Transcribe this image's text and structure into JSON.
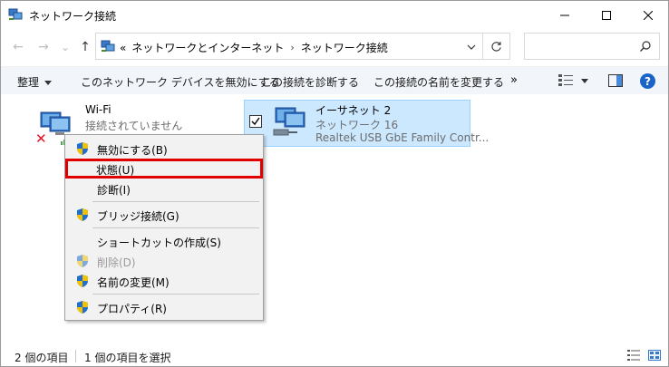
{
  "window": {
    "title": "ネットワーク接続"
  },
  "nav": {
    "back": "←",
    "forward": "→",
    "dropdown": "⌄",
    "up": "↑",
    "breadcrumb_prefix": "«",
    "breadcrumbs": [
      "ネットワークとインターネット",
      "ネットワーク接続"
    ],
    "breadcrumb_separator": "›",
    "search_placeholder": ""
  },
  "commands": {
    "organize": "整理",
    "disable_device": "このネットワーク デバイスを無効にする",
    "diagnose": "この接続を診断する",
    "rename": "この接続の名前を変更する",
    "more": "»"
  },
  "items": [
    {
      "name": "Wi-Fi",
      "status": "接続されていません"
    },
    {
      "name": "イーサネット 2",
      "network": "ネットワーク 16",
      "adapter": "Realtek USB GbE Family Contr..."
    }
  ],
  "context_menu": {
    "items": [
      {
        "label": "無効にする(B)",
        "icon": "shield-icon"
      },
      {
        "label": "状態(U)",
        "icon": ""
      },
      {
        "label": "診断(I)",
        "icon": ""
      },
      {
        "label": "ブリッジ接続(G)",
        "icon": "shield-icon"
      },
      {
        "label": "ショートカットの作成(S)",
        "icon": ""
      },
      {
        "label": "削除(D)",
        "icon": "shield-icon"
      },
      {
        "label": "名前の変更(M)",
        "icon": "shield-icon"
      },
      {
        "label": "プロパティ(R)",
        "icon": "shield-icon"
      }
    ]
  },
  "status_bar": {
    "item_count": "2 個の項目",
    "selected_count": "1 個の項目を選択"
  },
  "colors": {
    "selection_bg": "#cce8ff",
    "selection_border": "#99d1ff",
    "highlight_box": "#e00000",
    "help_blue": "#1a63c8",
    "disconnected_red": "#e81123"
  }
}
